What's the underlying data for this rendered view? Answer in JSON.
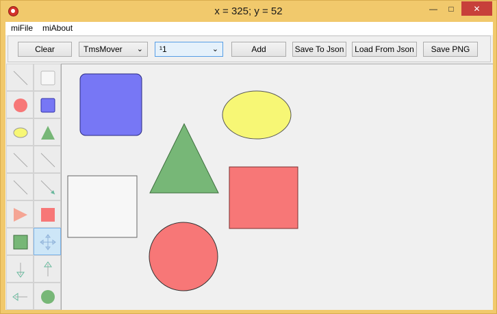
{
  "window": {
    "title": "x = 325; y = 52",
    "minimize_glyph": "—",
    "maximize_glyph": "□",
    "close_glyph": "✕"
  },
  "menu": {
    "file": "miFile",
    "about": "miAbout"
  },
  "toolbar": {
    "clear_label": "Clear",
    "mode_value": "TmsMover",
    "layer_value": "¹1",
    "add_label": "Add",
    "save_json_label": "Save To Json",
    "load_json_label": "Load From Json",
    "save_png_label": "Save PNG"
  },
  "colors": {
    "blue": "#7777f5",
    "yellow": "#f7f775",
    "green": "#77b777",
    "red": "#f77777",
    "white": "#f7f7f7",
    "salmon": "#f5a594",
    "teal": "#66b89c"
  },
  "tools": [
    {
      "icon": "line-icon"
    },
    {
      "icon": "white-square-icon"
    },
    {
      "icon": "red-circle-icon"
    },
    {
      "icon": "blue-square-icon"
    },
    {
      "icon": "yellow-ellipse-icon"
    },
    {
      "icon": "green-triangle-icon"
    },
    {
      "icon": "line-icon"
    },
    {
      "icon": "line-icon"
    },
    {
      "icon": "line-icon"
    },
    {
      "icon": "arrow-line-icon"
    },
    {
      "icon": "salmon-triangle-right-icon"
    },
    {
      "icon": "red-square-icon"
    },
    {
      "icon": "green-square-icon"
    },
    {
      "icon": "move-cross-icon"
    },
    {
      "icon": "arrow-down-icon"
    },
    {
      "icon": "arrow-up-icon"
    },
    {
      "icon": "arrow-left-icon"
    },
    {
      "icon": "green-circle-icon"
    }
  ],
  "active_tool": 13
}
